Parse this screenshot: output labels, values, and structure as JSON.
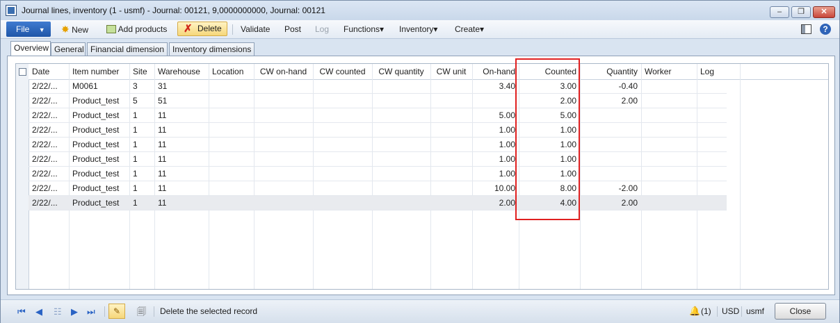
{
  "window": {
    "title": "Journal lines, inventory (1 - usmf) - Journal: 00121, 9,0000000000, Journal: 00121",
    "minimize": "–",
    "restore": "❐",
    "close": "✕"
  },
  "toolbar": {
    "file": "File",
    "new": "New",
    "add_products": "Add products",
    "delete": "Delete",
    "validate": "Validate",
    "post": "Post",
    "log": "Log",
    "functions": "Functions▾",
    "inventory": "Inventory▾",
    "create": "Create▾"
  },
  "tabs": [
    "Overview",
    "General",
    "Financial dimension",
    "Inventory dimensions"
  ],
  "columns": [
    "Date",
    "Item number",
    "Site",
    "Warehouse",
    "Location",
    "CW on-hand",
    "CW counted",
    "CW quantity",
    "CW unit",
    "On-hand",
    "Counted",
    "Quantity",
    "Worker",
    "Log"
  ],
  "rows": [
    {
      "date": "2/22/...",
      "item": "M0061",
      "site": "3",
      "warehouse": "31",
      "onhand": "3.40",
      "counted": "3.00",
      "quantity": "-0.40"
    },
    {
      "date": "2/22/...",
      "item": "Product_test",
      "site": "5",
      "warehouse": "51",
      "onhand": "",
      "counted": "2.00",
      "quantity": "2.00"
    },
    {
      "date": "2/22/...",
      "item": "Product_test",
      "site": "1",
      "warehouse": "11",
      "onhand": "5.00",
      "counted": "5.00",
      "quantity": ""
    },
    {
      "date": "2/22/...",
      "item": "Product_test",
      "site": "1",
      "warehouse": "11",
      "onhand": "1.00",
      "counted": "1.00",
      "quantity": ""
    },
    {
      "date": "2/22/...",
      "item": "Product_test",
      "site": "1",
      "warehouse": "11",
      "onhand": "1.00",
      "counted": "1.00",
      "quantity": ""
    },
    {
      "date": "2/22/...",
      "item": "Product_test",
      "site": "1",
      "warehouse": "11",
      "onhand": "1.00",
      "counted": "1.00",
      "quantity": ""
    },
    {
      "date": "2/22/...",
      "item": "Product_test",
      "site": "1",
      "warehouse": "11",
      "onhand": "1.00",
      "counted": "1.00",
      "quantity": ""
    },
    {
      "date": "2/22/...",
      "item": "Product_test",
      "site": "1",
      "warehouse": "11",
      "onhand": "10.00",
      "counted": "8.00",
      "quantity": "-2.00"
    },
    {
      "date": "2/22/...",
      "item": "Product_test",
      "site": "1",
      "warehouse": "11",
      "onhand": "2.00",
      "counted": "4.00",
      "quantity": "2.00"
    }
  ],
  "status": {
    "message": "Delete the selected record",
    "notifications": "(1)",
    "currency": "USD",
    "company": "usmf",
    "close": "Close"
  },
  "colors": {
    "accent": "#1f56a8",
    "highlight": "#e02020"
  }
}
